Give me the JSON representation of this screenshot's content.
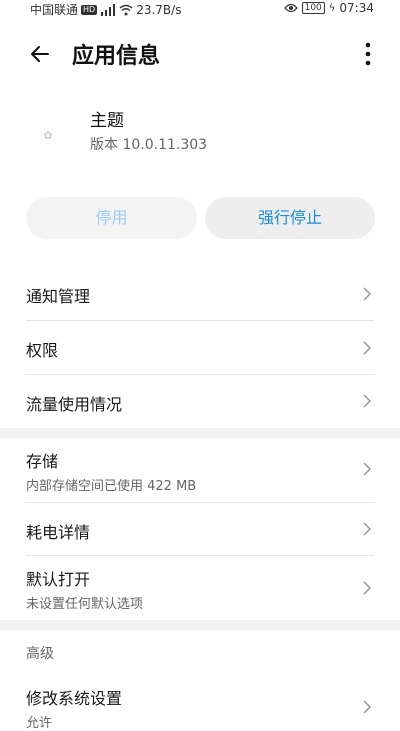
{
  "status_bar": {
    "carrier": "中国联通",
    "hd": "HD",
    "net_speed": "23.7B/s",
    "battery": "100",
    "time": "07:34"
  },
  "header": {
    "title": "应用信息"
  },
  "app": {
    "name": "主题",
    "version": "版本 10.0.11.303"
  },
  "buttons": {
    "disable": "停用",
    "force_stop": "强行停止"
  },
  "items": {
    "notifications": {
      "title": "通知管理"
    },
    "permissions": {
      "title": "权限"
    },
    "data_usage": {
      "title": "流量使用情况"
    },
    "storage": {
      "title": "存储",
      "subtitle": "内部存储空间已使用 422 MB"
    },
    "battery": {
      "title": "耗电详情"
    },
    "open_by_default": {
      "title": "默认打开",
      "subtitle": "未设置任何默认选项"
    },
    "advanced_header": "高级",
    "modify_settings": {
      "title": "修改系统设置",
      "subtitle": "允许"
    }
  },
  "colors": {
    "accent": "#1a8cd8",
    "disabled_text": "#9dccef",
    "button_bg": "#eeeeee"
  }
}
